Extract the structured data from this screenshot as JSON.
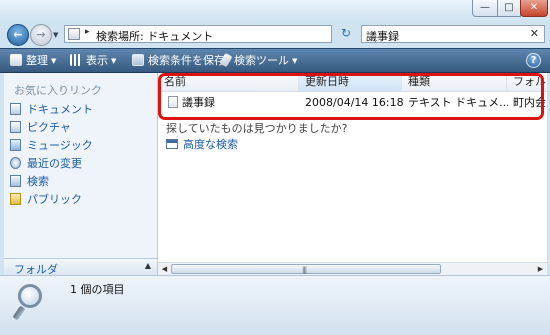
{
  "window": {
    "minimize_glyph": "—",
    "maximize_glyph": "□",
    "close_glyph": "✕"
  },
  "address_bar": {
    "back_glyph": "←",
    "forward_glyph": "→",
    "separator_glyph": "▸",
    "location": "検索場所: ドキュメント",
    "refresh_glyph": "↻"
  },
  "search": {
    "query": "議事録",
    "clear_glyph": "✕"
  },
  "toolbar": {
    "organize": "整理",
    "views": "表示",
    "save_search": "検索条件を保存",
    "search_tools": "検索ツール",
    "help_glyph": "?"
  },
  "sidebar": {
    "favorites_title": "お気に入りリンク",
    "items": [
      {
        "label": "ドキュメント",
        "icon": "documents-icon"
      },
      {
        "label": "ピクチャ",
        "icon": "pictures-icon"
      },
      {
        "label": "ミュージック",
        "icon": "music-icon"
      },
      {
        "label": "最近の変更",
        "icon": "recent-changes-icon"
      },
      {
        "label": "検索",
        "icon": "searches-icon"
      },
      {
        "label": "パブリック",
        "icon": "public-folder-icon"
      }
    ],
    "folders_label": "フォルダ"
  },
  "file_list": {
    "columns": [
      "名前",
      "更新日時",
      "種類",
      "フォルダ"
    ],
    "sorted_column": "更新日時",
    "rows": [
      {
        "name": "議事録",
        "modified": "2008/04/14 16:18",
        "type": "テキスト ドキュメ...",
        "folder": "町内会"
      }
    ],
    "not_found_prompt": "探していたものは見つかりましたか?",
    "advanced_search": "高度な検索"
  },
  "details": {
    "item_count": "1 個の項目"
  },
  "colors": {
    "highlight_border": "#dd1111",
    "toolbar_dark": "#35597f",
    "link_blue": "#1c5da0"
  }
}
